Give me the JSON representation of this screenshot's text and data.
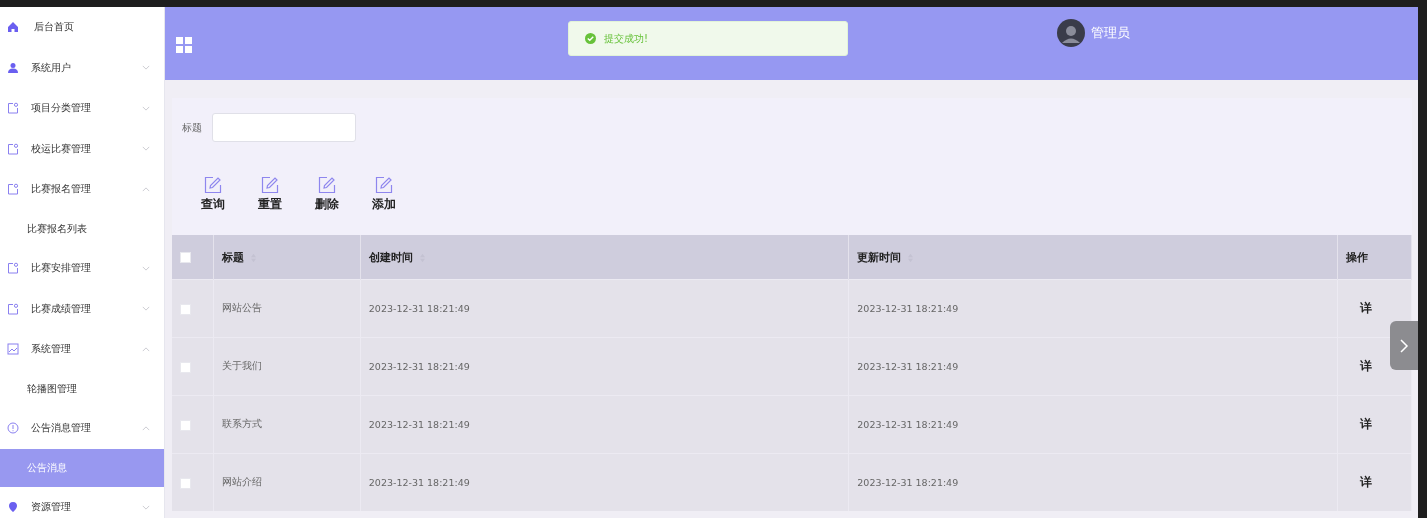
{
  "sidebar": {
    "items": [
      {
        "label": "后台首页",
        "kind": "home"
      },
      {
        "label": "系统用户",
        "kind": "user",
        "expanded": false
      },
      {
        "label": "项目分类管理",
        "kind": "folder",
        "expanded": false
      },
      {
        "label": "校运比赛管理",
        "kind": "folder",
        "expanded": false
      },
      {
        "label": "比赛报名管理",
        "kind": "folder",
        "expanded": true,
        "children": [
          {
            "label": "比赛报名列表",
            "selected": false
          }
        ]
      },
      {
        "label": "比赛安排管理",
        "kind": "folder",
        "expanded": false
      },
      {
        "label": "比赛成绩管理",
        "kind": "folder",
        "expanded": false
      },
      {
        "label": "系统管理",
        "kind": "image",
        "expanded": true,
        "children": [
          {
            "label": "轮播图管理",
            "selected": false
          }
        ]
      },
      {
        "label": "公告消息管理",
        "kind": "info",
        "expanded": true,
        "children": [
          {
            "label": "公告消息",
            "selected": true
          }
        ]
      },
      {
        "label": "资源管理",
        "kind": "pin",
        "expanded": false
      }
    ]
  },
  "toast": {
    "text": "提交成功!"
  },
  "user": {
    "name": "管理员"
  },
  "filter": {
    "label": "标题"
  },
  "actions": [
    "查询",
    "重置",
    "删除",
    "添加"
  ],
  "table": {
    "columns": [
      "标题",
      "创建时间",
      "更新时间",
      "操作"
    ],
    "select_all_checked": false,
    "rows": [
      {
        "title": "网站公告",
        "created": "2023-12-31 18:21:49",
        "updated": "2023-12-31 18:21:49",
        "action": "详",
        "checked": false
      },
      {
        "title": "关于我们",
        "created": "2023-12-31 18:21:49",
        "updated": "2023-12-31 18:21:49",
        "action": "详",
        "checked": false
      },
      {
        "title": "联系方式",
        "created": "2023-12-31 18:21:49",
        "updated": "2023-12-31 18:21:49",
        "action": "详",
        "checked": false
      },
      {
        "title": "网站介绍",
        "created": "2023-12-31 18:21:49",
        "updated": "2023-12-31 18:21:49",
        "action": "详",
        "checked": false
      }
    ]
  }
}
